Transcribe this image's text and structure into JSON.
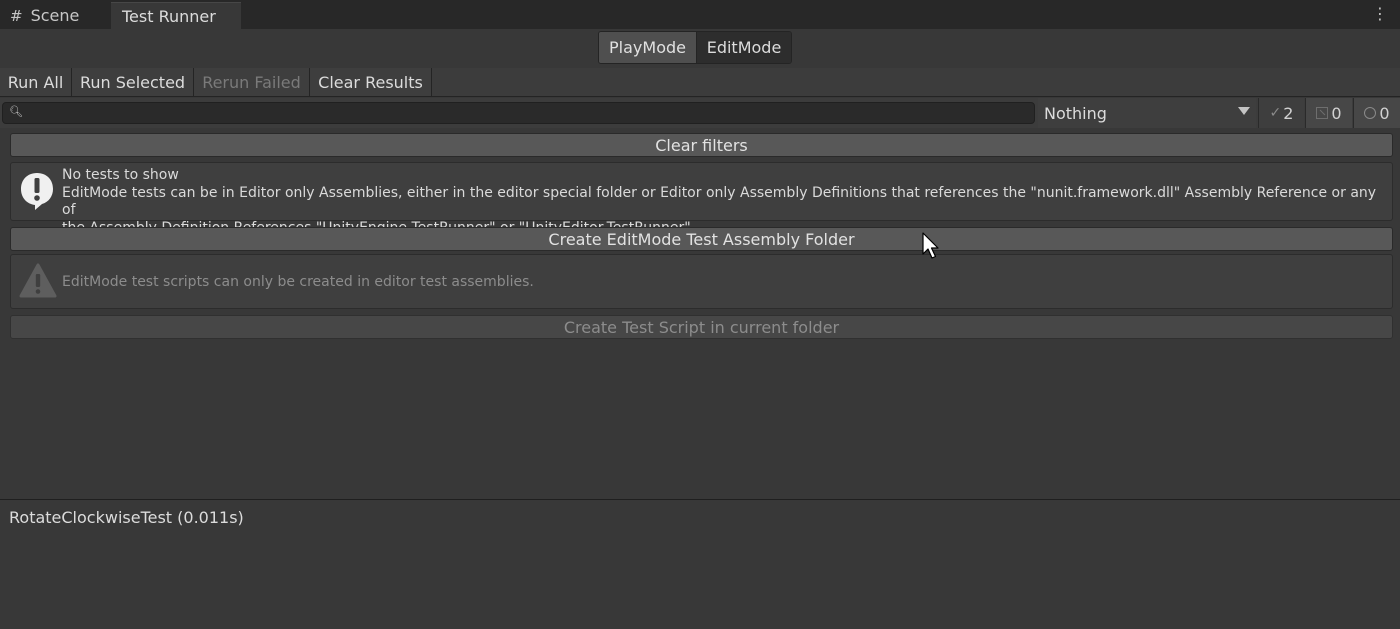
{
  "tabs": {
    "scene_label": "Scene",
    "test_runner_label": "Test Runner",
    "scene_icon": "grid-hash-icon",
    "menu_icon": "kebab-menu-icon"
  },
  "mode_toggle": {
    "playmode_label": "PlayMode",
    "editmode_label": "EditMode",
    "selected": "PlayMode"
  },
  "toolbar": {
    "run_all_label": "Run All",
    "run_selected_label": "Run Selected",
    "rerun_failed_label": "Rerun Failed",
    "clear_results_label": "Clear Results"
  },
  "filter_bar": {
    "search_value": "",
    "search_icon": "magnifier-icon",
    "category_selected": "Nothing",
    "passed_count": "2",
    "failed_count": "0",
    "skipped_count": "0"
  },
  "main": {
    "clear_filters_label": "Clear filters",
    "info_title": "No tests to show",
    "info_body_line1": "EditMode tests can be in Editor only Assemblies, either in the editor special folder or Editor only Assembly Definitions that references the \"nunit.framework.dll\" Assembly Reference or any of",
    "info_body_line2": "the Assembly Definition References \"UnityEngine.TestRunner\" or \"UnityEditor.TestRunner\"..",
    "create_folder_label": "Create EditMode Test Assembly Folder",
    "warning_text": "EditMode test scripts can only be created in editor test assemblies.",
    "create_script_label": "Create Test Script in current folder"
  },
  "details": {
    "result_text": "RotateClockwiseTest (0.011s)"
  },
  "colors": {
    "window_bg": "#383838",
    "tabbar_bg": "#282828",
    "button_bg": "#585858",
    "disabled_text": "#7a7a7a"
  }
}
